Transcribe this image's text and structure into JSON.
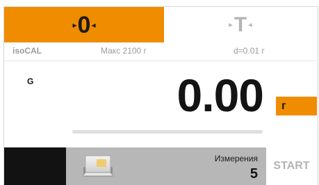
{
  "header": {
    "zero_label": "0",
    "tare_label": "T"
  },
  "info": {
    "mode": "isoCAL",
    "max": "Макс 2100 г",
    "readability": "d=0.01 г"
  },
  "display": {
    "net_gross_label": "G",
    "weight_value": "0.00",
    "unit": "г",
    "progress_fraction": 0.0
  },
  "bottom": {
    "measurements_label": "Измерения",
    "measurements_count": "5",
    "start_label": "START"
  },
  "colors": {
    "accent": "#f08c00",
    "text_dark": "#141414",
    "text_muted": "#9a9a9a"
  },
  "icons": {
    "zero_arrows": "triangle-pointers",
    "tare_arrows": "triangle-pointers",
    "app_icon": "document-folder-icon"
  }
}
